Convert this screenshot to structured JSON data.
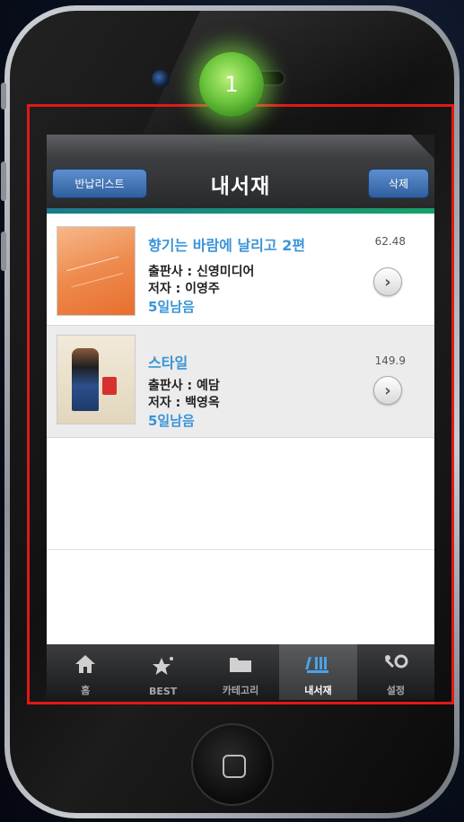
{
  "badge": {
    "number": "1"
  },
  "navbar": {
    "title": "내서재",
    "left_button": "반납리스트",
    "right_button": "삭제"
  },
  "books": [
    {
      "title": "향기는 바람에 날리고 2편",
      "publisher": "출판사 : 신영미디어",
      "author": "저자 : 이영주",
      "days_left": "5일남음",
      "size": "62.48"
    },
    {
      "title": "스타일",
      "publisher": "출판사 : 예담",
      "author": "저자 : 백영옥",
      "days_left": "5일남음",
      "size": "149.9"
    }
  ],
  "tabs": [
    {
      "label": "홈",
      "icon": "home-icon"
    },
    {
      "label": "BEST",
      "icon": "star-icon"
    },
    {
      "label": "카테고리",
      "icon": "folder-icon"
    },
    {
      "label": "내서재",
      "icon": "bookshelf-icon",
      "active": true
    },
    {
      "label": "설정",
      "icon": "wrench-icon"
    }
  ],
  "colors": {
    "accent_blue": "#3a94d6",
    "highlight_red": "#e01818",
    "badge_green": "#6dc63d"
  }
}
